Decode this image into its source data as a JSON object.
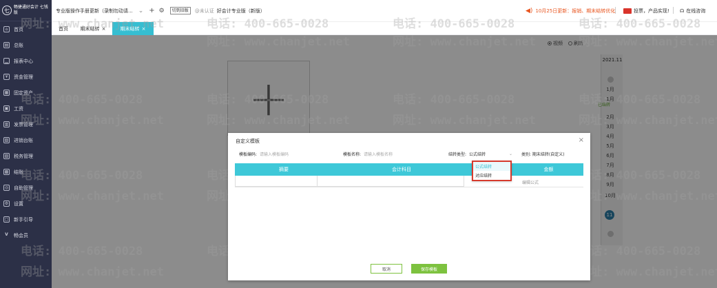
{
  "app": {
    "logo_text": "畅捷通好会计 七钱版",
    "company": "专业版操作手册更新（录制勿动请...",
    "switch_old": "切到旧版",
    "unverified": "@未认证",
    "edition": "好会计专业版（新版）",
    "notice": "10月25日更新：报销、期末结转优化",
    "vote": "投票，产品实现!",
    "consult": "在线咨询"
  },
  "sidebar": {
    "items": [
      {
        "label": "首页",
        "icon": "home-icon"
      },
      {
        "label": "总账",
        "icon": "ledger-icon"
      },
      {
        "label": "报表中心",
        "icon": "chart-icon"
      },
      {
        "label": "资金管理",
        "icon": "fund-icon"
      },
      {
        "label": "固定资产",
        "icon": "asset-icon"
      },
      {
        "label": "工资",
        "icon": "salary-icon"
      },
      {
        "label": "发票管理",
        "icon": "invoice-icon"
      },
      {
        "label": "进销台账",
        "icon": "inventory-icon"
      },
      {
        "label": "税务管理",
        "icon": "tax-icon"
      },
      {
        "label": "结账",
        "icon": "close-account-icon"
      },
      {
        "label": "自助管理",
        "icon": "self-service-icon"
      },
      {
        "label": "设置",
        "icon": "settings-icon"
      },
      {
        "label": "新手引导",
        "icon": "guide-icon"
      },
      {
        "label": "畅会员",
        "icon": "vip-icon"
      }
    ]
  },
  "tabs": {
    "home": "首页",
    "tab1": "期末结转",
    "tab2": "期末结转"
  },
  "main": {
    "view_video": "视频",
    "view_refresh": "刷新",
    "year": "2021.11",
    "months": [
      "1月",
      "2月",
      "3月",
      "4月",
      "5月",
      "6月",
      "7月",
      "8月",
      "9月",
      "10月"
    ],
    "current_month": "11",
    "done_label": "已结转"
  },
  "modal": {
    "title": "自定义模板",
    "code_label": "模板编码:",
    "code_placeholder": "请输入模板编码",
    "name_label": "模板名称:",
    "name_placeholder": "请输入模板名称",
    "type_label": "结转类型:",
    "type_value": "公式结转",
    "category": "类别: 期末结转(自定义)",
    "col_summary": "摘要",
    "col_account": "会计科目",
    "col_direction": "金额",
    "edit_formula": "编辑公式",
    "dropdown_options": [
      "公式结转",
      "对应结转"
    ],
    "cancel": "取消",
    "save": "保存模板"
  },
  "watermark": {
    "phone": "电话: 400-665-0028",
    "site": "网址: www.chanjet.net"
  },
  "colors": {
    "accent": "#36bed1",
    "sidebar": "#2c3047",
    "save_green": "#7dc23f",
    "highlight_red": "#d73a2d",
    "notice_orange": "#e8551f"
  }
}
